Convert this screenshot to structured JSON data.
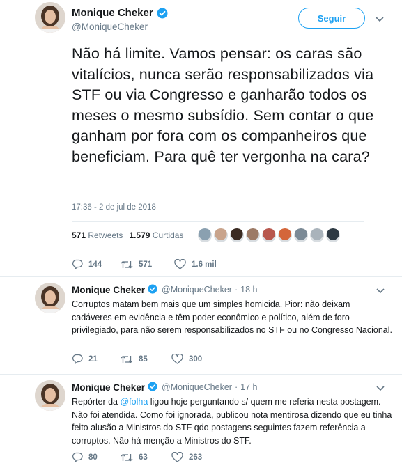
{
  "main_tweet": {
    "display_name": "Monique Cheker",
    "handle": "@MoniqueCheker",
    "follow_label": "Seguir",
    "text": "Não há limite. Vamos pensar: os caras são vitalícios, nunca serão responsabilizados via STF ou via Congresso e ganharão todos os meses o mesmo subsídio. Sem contar o que ganham por fora com os companheiros que beneficiam. Para quê ter vergonha na cara?",
    "timestamp": "17:36 - 2 de jul de 2018",
    "retweets_count": "571",
    "retweets_label": "Retweets",
    "likes_count": "1.579",
    "likes_label": "Curtidas",
    "likers_colors": [
      "#8aa0b0",
      "#c9a48c",
      "#3a2a22",
      "#9c7a66",
      "#b8584e",
      "#d4663a",
      "#7b8a96",
      "#a9b3bb",
      "#2e3a44"
    ],
    "actions": {
      "replies": "144",
      "retweets": "571",
      "likes": "1.6 mil"
    }
  },
  "replies": [
    {
      "display_name": "Monique Cheker",
      "handle": "@MoniqueCheker",
      "separator": "·",
      "time": "18 h",
      "text": "Corruptos matam bem mais que um simples homicida. Pior: não deixam cadáveres em evidência e têm poder econômico e político, além de foro privilegiado, para não serem responsabilizados no STF ou no Congresso Nacional.",
      "actions": {
        "replies": "21",
        "retweets": "85",
        "likes": "300"
      }
    },
    {
      "display_name": "Monique Cheker",
      "handle": "@MoniqueCheker",
      "separator": "·",
      "time": "17 h",
      "text_before": "Repórter da ",
      "mention": "@folha",
      "text_after": " ligou hoje perguntando s/ quem me referia nesta postagem. Não foi atendida. Como foi ignorada, publicou nota mentirosa dizendo que eu tinha feito alusão a Ministros do STF qdo postagens seguintes fazem referência a corruptos. Não há menção a Ministros do STF.",
      "actions": {
        "replies": "80",
        "retweets": "63",
        "likes": "263"
      }
    }
  ],
  "colors": {
    "accent": "#1da1f2",
    "text": "#14171a",
    "secondary": "#657786",
    "divider": "#e6ecf0"
  },
  "icons": [
    "verified-badge-icon",
    "chevron-down-icon",
    "reply-icon",
    "retweet-icon",
    "like-icon"
  ]
}
